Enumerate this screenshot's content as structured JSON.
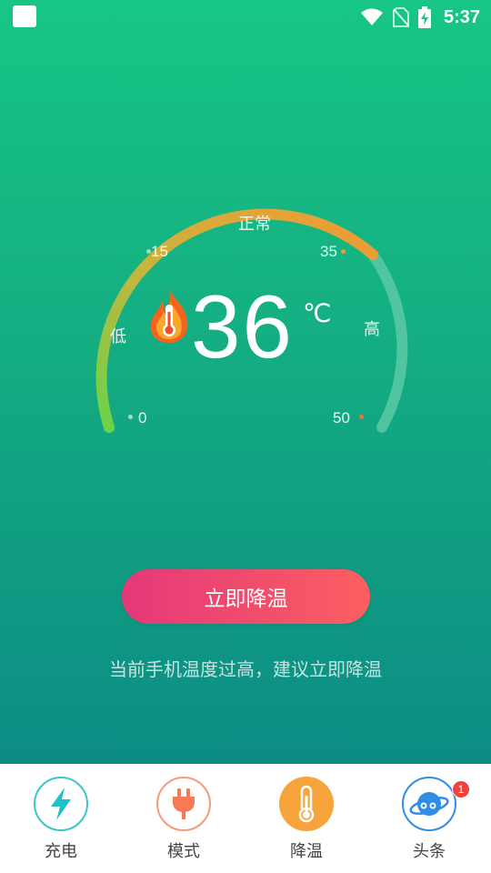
{
  "status_bar": {
    "time": "5:37",
    "icons": [
      "app-square-icon",
      "wifi-icon",
      "no-sim-icon",
      "battery-charging-icon"
    ]
  },
  "gauge": {
    "value": "36",
    "unit": "℃",
    "zone_labels": {
      "low": "低",
      "normal": "正常",
      "high": "高"
    },
    "ticks": {
      "t0": "0",
      "t15": "15",
      "t35": "35",
      "t50": "50"
    },
    "colors": {
      "green": "#6ad34a",
      "yellow": "#c8b43e",
      "orange": "#f29a33",
      "track": "#5bc9a6"
    },
    "icon": "thermometer-flame-icon"
  },
  "action": {
    "cool_button": "立即降温",
    "hint": "当前手机温度过高，建议立即降温"
  },
  "bottom_nav": {
    "items": [
      {
        "label": "充电",
        "icon": "lightning-icon"
      },
      {
        "label": "模式",
        "icon": "plug-icon"
      },
      {
        "label": "降温",
        "icon": "thermometer-icon"
      },
      {
        "label": "头条",
        "icon": "planet-icon",
        "badge": "1"
      }
    ]
  }
}
